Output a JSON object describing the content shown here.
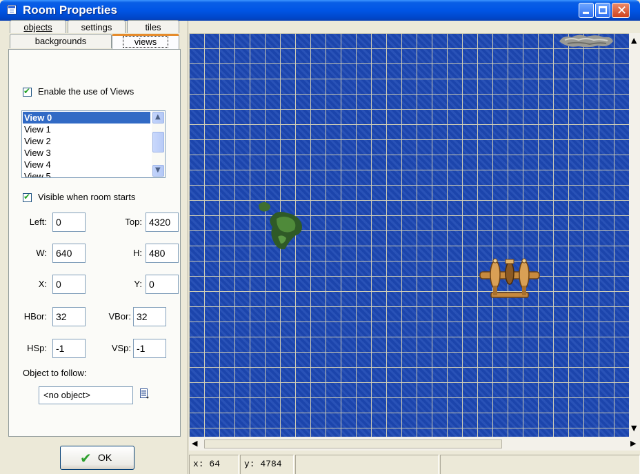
{
  "window": {
    "title": "Room Properties"
  },
  "tabs": {
    "objects": "objects",
    "settings": "settings",
    "tiles": "tiles",
    "backgrounds": "backgrounds",
    "views": "views",
    "active": "views"
  },
  "views_panel": {
    "enable_views_label": "Enable the use of Views",
    "enable_views_checked": true,
    "view_list": [
      "View 0",
      "View 1",
      "View 2",
      "View 3",
      "View 4",
      "View 5"
    ],
    "selected_view": "View 0",
    "visible_label": "Visible when room starts",
    "visible_checked": true,
    "fields": {
      "left": {
        "label": "Left:",
        "value": "0"
      },
      "top": {
        "label": "Top:",
        "value": "4320"
      },
      "w": {
        "label": "W:",
        "value": "640"
      },
      "h": {
        "label": "H:",
        "value": "480"
      },
      "x": {
        "label": "X:",
        "value": "0"
      },
      "y": {
        "label": "Y:",
        "value": "0"
      },
      "hbor": {
        "label": "HBor:",
        "value": "32"
      },
      "vbor": {
        "label": "VBor:",
        "value": "32"
      },
      "hsp": {
        "label": "HSp:",
        "value": "-1"
      },
      "vsp": {
        "label": "VSp:",
        "value": "-1"
      }
    },
    "object_to_follow_label": "Object to follow:",
    "object_to_follow_value": "<no object>"
  },
  "ok_button": {
    "label": "OK"
  },
  "status": {
    "x": "x: 64",
    "y": "y: 4784"
  },
  "colors": {
    "title_bar": "#0055e5",
    "room_water": "#1e49b3",
    "grid_line": "#d7d2b4",
    "selection": "#316ac5"
  },
  "icons": {
    "window": "window-icon",
    "minimize": "minimize-icon",
    "maximize": "maximize-icon",
    "close": "close-icon",
    "ok": "check-icon",
    "object_menu": "list-menu-icon"
  }
}
